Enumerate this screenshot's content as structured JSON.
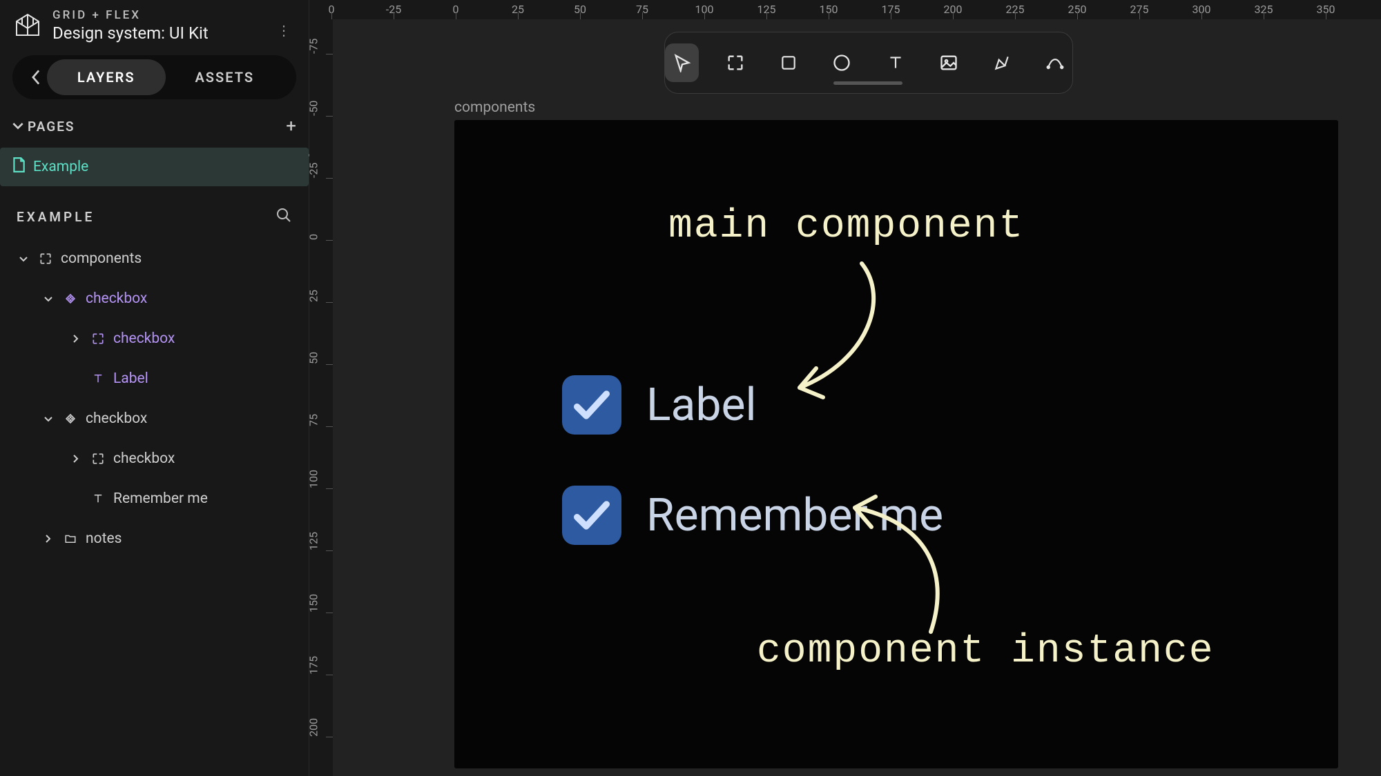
{
  "header": {
    "product": "GRID + FLEX",
    "filename": "Design system: UI Kit"
  },
  "tabs": {
    "layers": "LAYERS",
    "assets": "ASSETS"
  },
  "pages": {
    "section_label": "PAGES",
    "items": [
      {
        "name": "Example"
      }
    ]
  },
  "layer_panel": {
    "title": "EXAMPLE"
  },
  "tree": [
    {
      "level": 1,
      "expanded": true,
      "icon": "frame",
      "label": "components",
      "color": "grey"
    },
    {
      "level": 2,
      "expanded": true,
      "icon": "component",
      "label": "checkbox",
      "color": "purple"
    },
    {
      "level": 3,
      "expanded": false,
      "icon": "frame",
      "label": "checkbox",
      "color": "purple"
    },
    {
      "level": 3,
      "expanded": null,
      "icon": "text",
      "label": "Label",
      "color": "purple"
    },
    {
      "level": 2,
      "expanded": true,
      "icon": "component",
      "label": "checkbox",
      "color": "grey"
    },
    {
      "level": 3,
      "expanded": false,
      "icon": "frame",
      "label": "checkbox",
      "color": "grey"
    },
    {
      "level": 3,
      "expanded": null,
      "icon": "text",
      "label": "Remember me",
      "color": "grey"
    },
    {
      "level": 2,
      "expanded": false,
      "icon": "folder",
      "label": "notes",
      "color": "grey"
    }
  ],
  "ruler": {
    "h": [
      "0",
      "-25",
      "0",
      "25",
      "50",
      "75",
      "100",
      "125",
      "150",
      "175",
      "200",
      "225",
      "250",
      "275",
      "300",
      "325",
      "350"
    ],
    "v": [
      "-75",
      "-50",
      "-25",
      "0",
      "25",
      "50",
      "75",
      "100",
      "125",
      "150",
      "175",
      "200"
    ]
  },
  "canvas": {
    "frame_label": "components",
    "annot_main": "main component",
    "annot_instance": "component instance",
    "checkbox1_label": "Label",
    "checkbox2_label": "Remember me"
  },
  "tools": [
    "select",
    "frame",
    "rectangle",
    "ellipse",
    "text",
    "image",
    "pen",
    "curve"
  ]
}
